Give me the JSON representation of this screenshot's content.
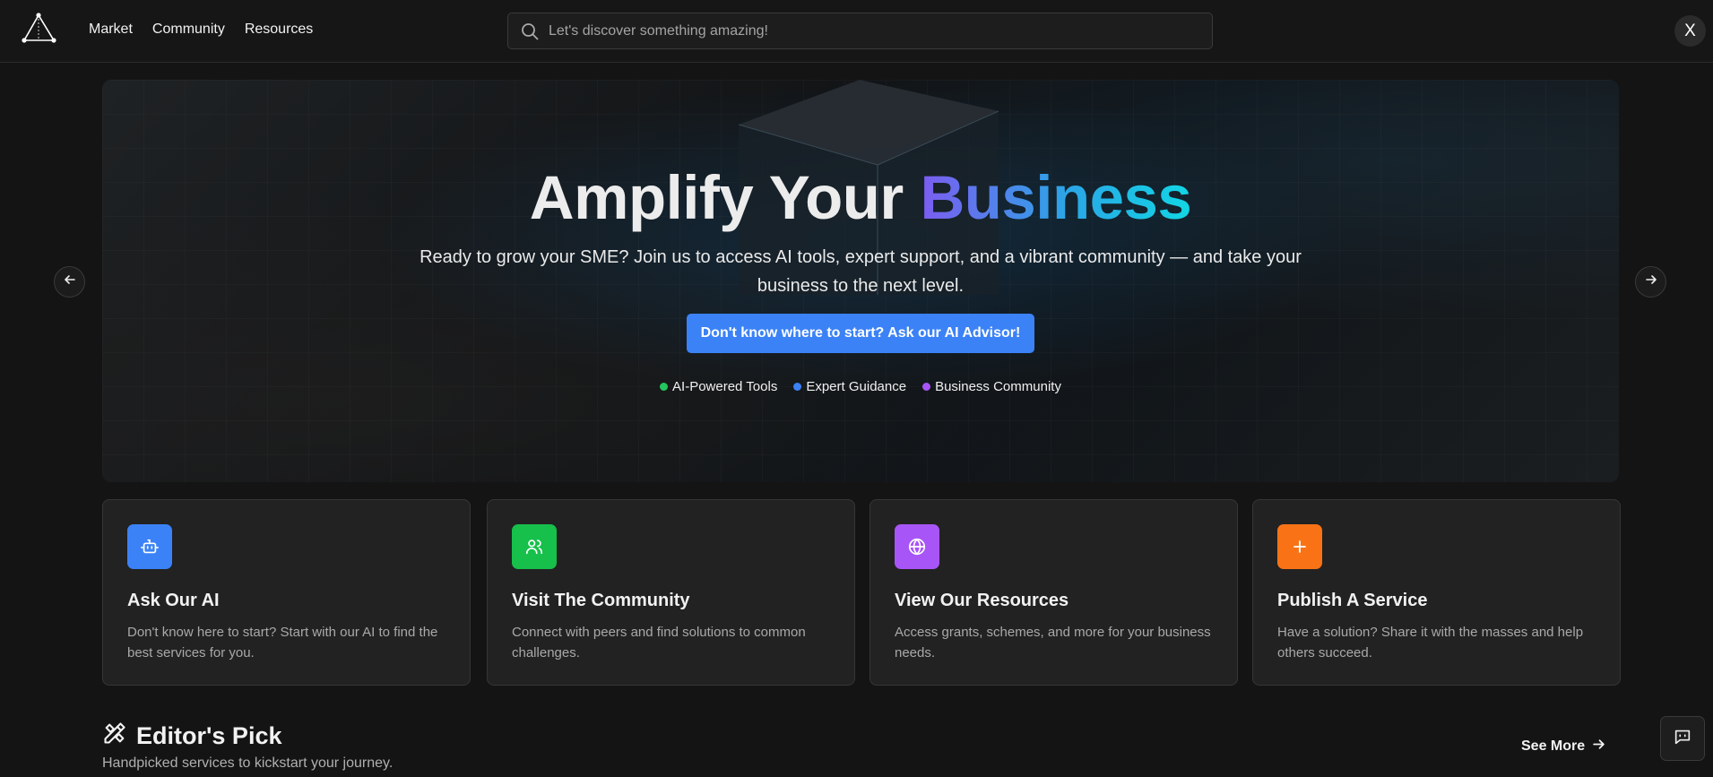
{
  "nav": {
    "logo_icon": "triangle-network-icon",
    "items": [
      {
        "label": "Market"
      },
      {
        "label": "Community"
      },
      {
        "label": "Resources"
      }
    ],
    "search": {
      "placeholder": "Let's discover something amazing!",
      "icon": "search-icon"
    },
    "close_label": "X"
  },
  "hero": {
    "title_main": "Amplify Your ",
    "title_accent": "Business",
    "subtitle": "Ready to grow your SME? Join us to access AI tools, expert support, and a vibrant community — and take your business to the next level.",
    "cta_label": "Don't know where to start? Ask our AI Advisor!",
    "tags": [
      {
        "label": "AI-Powered Tools",
        "color": "#22c55e"
      },
      {
        "label": "Expert Guidance",
        "color": "#3b82f6"
      },
      {
        "label": "Business Community",
        "color": "#a855f7"
      }
    ],
    "prev_icon": "arrow-left-icon",
    "next_icon": "arrow-right-icon"
  },
  "cards": [
    {
      "title": "Ask Our AI",
      "desc": "Don't know here to start? Start with our AI to find the best services for you.",
      "color": "#3b82f6",
      "icon": "bot-icon"
    },
    {
      "title": "Visit The Community",
      "desc": "Connect with peers and find solutions to common challenges.",
      "color": "#16c04a",
      "icon": "users-icon"
    },
    {
      "title": "View Our Resources",
      "desc": "Access grants, schemes, and more for your business needs.",
      "color": "#a855f7",
      "icon": "globe-icon"
    },
    {
      "title": "Publish A Service",
      "desc": "Have a solution? Share it with the masses and help others succeed.",
      "color": "#f97316",
      "icon": "plus-icon"
    }
  ],
  "editors_pick": {
    "icon": "pencil-ruler-icon",
    "title": "Editor's Pick",
    "subtitle": "Handpicked services to kickstart your journey.",
    "see_more": "See More"
  },
  "chat_icon": "chat-bot-icon"
}
